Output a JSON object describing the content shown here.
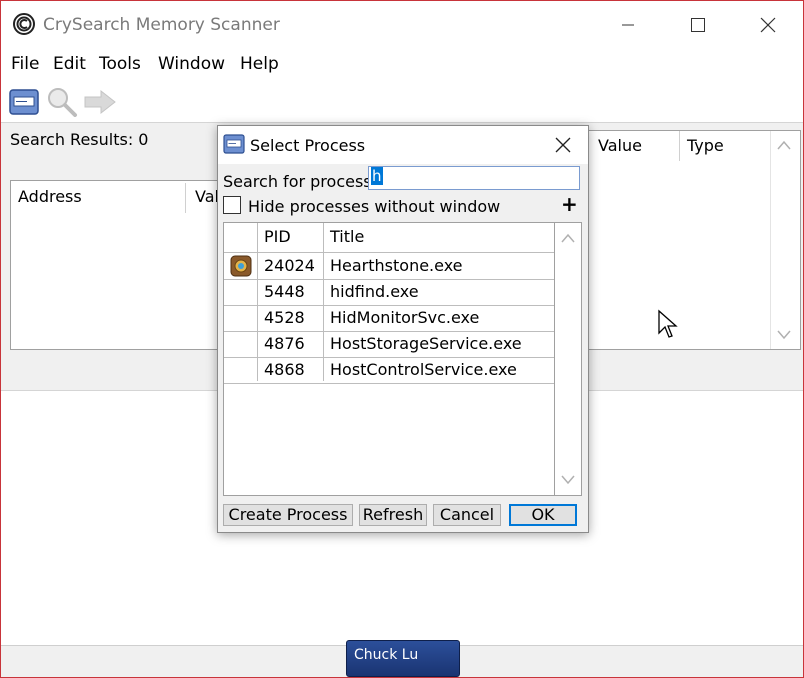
{
  "window": {
    "title": "CrySearch Memory Scanner",
    "minimize_glyph": "–",
    "close_glyph": "✕"
  },
  "menu": [
    {
      "label": "File"
    },
    {
      "label": "Edit"
    },
    {
      "label": "Tools"
    },
    {
      "label": "Window"
    },
    {
      "label": "Help"
    }
  ],
  "toolbar": {
    "icons": [
      "open-process-icon",
      "search-icon",
      "forward-arrow-icon"
    ]
  },
  "main": {
    "search_results": "Search Results: 0",
    "address_col": "Address",
    "value_col_partial": "Val",
    "right_value_col": "Value",
    "right_type_col": "Type"
  },
  "dialog": {
    "title": "Select Process",
    "search_label": "Search for process",
    "search_value": "h",
    "hide_label": "Hide processes without window",
    "plus": "+",
    "columns": {
      "pid": "PID",
      "title": "Title"
    },
    "rows": [
      {
        "pid": "24024",
        "title": "Hearthstone.exe",
        "icon": "hearthstone-icon"
      },
      {
        "pid": "5448",
        "title": "hidfind.exe"
      },
      {
        "pid": "4528",
        "title": "HidMonitorSvc.exe"
      },
      {
        "pid": "4876",
        "title": "HostStorageService.exe"
      },
      {
        "pid": "4868",
        "title": "HostControlService.exe"
      }
    ],
    "buttons": {
      "create": "Create Process",
      "refresh": "Refresh",
      "cancel": "Cancel",
      "ok": "OK"
    },
    "close_glyph": "✕"
  },
  "taskbar": {
    "user": "Chuck Lu"
  },
  "colors": {
    "window_border": "#c8343a",
    "selection": "#0078d7",
    "taskbar": "#1a3472"
  }
}
